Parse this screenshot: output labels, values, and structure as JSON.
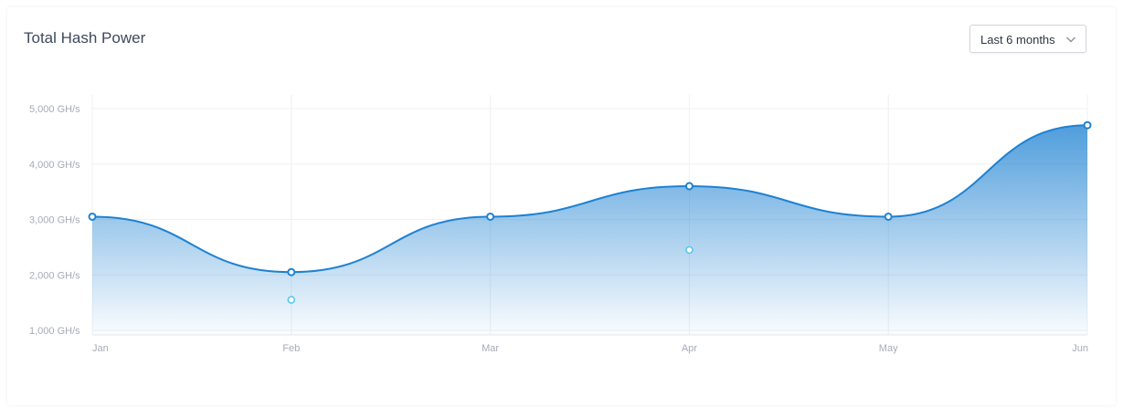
{
  "header": {
    "title": "Total Hash Power",
    "range_select": {
      "value": "Last 6 months",
      "icon": "chevron-down-icon"
    }
  },
  "chart_data": {
    "type": "area",
    "title": "Total Hash Power",
    "categories": [
      "Jan",
      "Feb",
      "Mar",
      "Apr",
      "May",
      "Jun"
    ],
    "ylim": [
      1000,
      5000
    ],
    "y_ticks": [
      "5,000 GH/s",
      "4,000 GH/s",
      "3,000 GH/s",
      "2,000 GH/s",
      "1,000 GH/s"
    ],
    "y_tick_values": [
      5000,
      4000,
      3000,
      2000,
      1000
    ],
    "grid": true,
    "series": [
      {
        "values": [
          3050,
          2050,
          3050,
          3600,
          3050,
          4700
        ],
        "color": "#1e82d2"
      },
      {
        "points": [
          {
            "x": "Feb",
            "y": 1550
          },
          {
            "x": "Apr",
            "y": 2450
          }
        ],
        "color": "#5bc8e8"
      }
    ]
  }
}
